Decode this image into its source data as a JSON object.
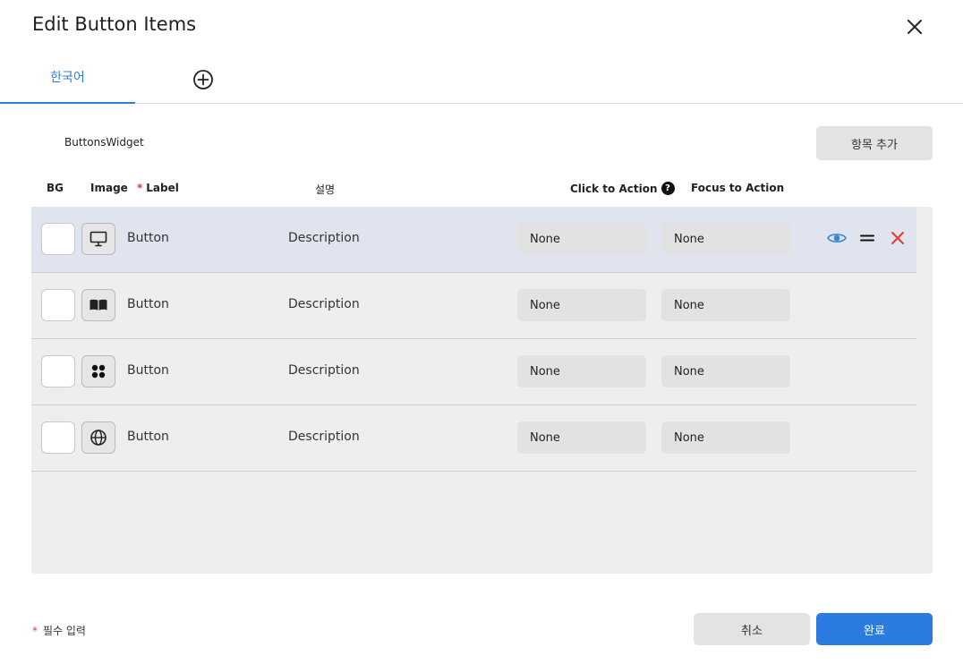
{
  "dialog": {
    "title": "Edit Button Items",
    "close_icon": "close-icon"
  },
  "tabs": {
    "items": [
      {
        "label": "한국어",
        "active": true
      }
    ],
    "add_icon": "plus-circle-icon"
  },
  "widget": {
    "name": "ButtonsWidget",
    "add_item_label": "항목 추가"
  },
  "columns": {
    "bg": "BG",
    "image": "Image",
    "required_mark": "*",
    "label": "Label",
    "description": "설명",
    "click_action": "Click to Action",
    "focus_action": "Focus to Action"
  },
  "rows": [
    {
      "image_icon": "monitor-icon",
      "label": "Button",
      "description": "Description",
      "click_action": "None",
      "focus_action": "None",
      "selected": true
    },
    {
      "image_icon": "book-icon",
      "label": "Button",
      "description": "Description",
      "click_action": "None",
      "focus_action": "None",
      "selected": false
    },
    {
      "image_icon": "apps-icon",
      "label": "Button",
      "description": "Description",
      "click_action": "None",
      "focus_action": "None",
      "selected": false
    },
    {
      "image_icon": "globe-icon",
      "label": "Button",
      "description": "Description",
      "click_action": "None",
      "focus_action": "None",
      "selected": false
    }
  ],
  "row_action_icons": [
    "eye-icon",
    "drag-handle-icon",
    "delete-icon"
  ],
  "footer": {
    "required_mark": "*",
    "required_note": "필수 입력",
    "cancel_label": "취소",
    "done_label": "완료"
  },
  "colors": {
    "accent": "#2c7be0",
    "required": "#e53935",
    "selected_row": "#dfe4ee",
    "list_bg": "#eeeeee"
  }
}
